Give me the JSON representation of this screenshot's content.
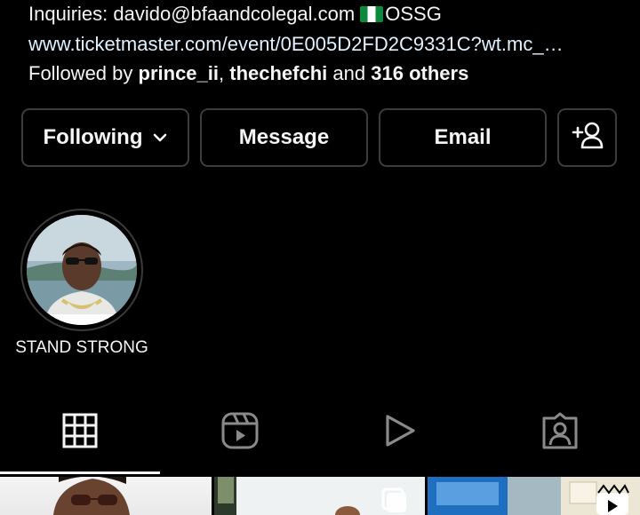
{
  "bio": {
    "inquiries_prefix": "Inquiries: davido@bfaandcolegal.com",
    "flag_icon": "nigeria-flag",
    "inquiries_suffix": "OSSG",
    "link": "www.ticketmaster.com/event/0E005D2FD2C9331C?wt.mc_…",
    "followed_by_prefix": "Followed by",
    "followed_user_1": "prince_ii",
    "followed_separator": ",",
    "followed_user_2": "thechefchi",
    "followed_and": "and",
    "followed_others": "316 others"
  },
  "actions": {
    "following_label": "Following",
    "message_label": "Message",
    "email_label": "Email",
    "add_user_icon": "add-person-icon"
  },
  "highlights": [
    {
      "label": "STAND STRONG"
    }
  ],
  "tabs": [
    {
      "icon": "grid-icon",
      "selected": true
    },
    {
      "icon": "reels-icon",
      "selected": false
    },
    {
      "icon": "play-icon",
      "selected": false
    },
    {
      "icon": "tagged-person-icon",
      "selected": false
    }
  ],
  "colors": {
    "background": "#000000",
    "text": "#f5f5f5",
    "link": "#e0f1ff",
    "button_border": "#3c3c3c",
    "flag_green": "#0a8a3a"
  }
}
